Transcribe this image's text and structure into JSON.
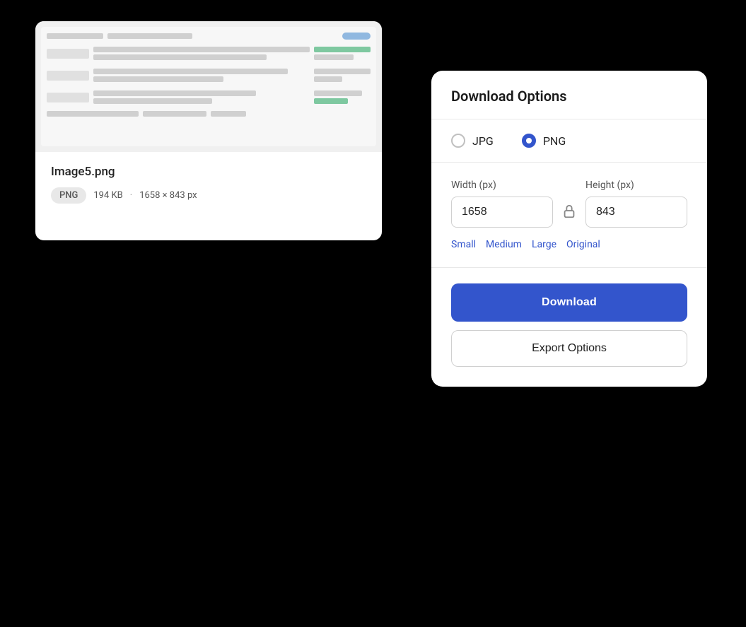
{
  "bg_card": {
    "filename": "Image5.png",
    "badge": "PNG",
    "file_size": "194 KB",
    "dot": "·",
    "dimensions": "1658 × 843 px"
  },
  "fg_card": {
    "title": "Download Options",
    "format_section": {
      "options": [
        {
          "id": "jpg",
          "label": "JPG",
          "selected": false
        },
        {
          "id": "png",
          "label": "PNG",
          "selected": true
        }
      ]
    },
    "dimensions": {
      "width_label": "Width (px)",
      "height_label": "Height (px)",
      "width_value": "1658",
      "height_value": "843"
    },
    "presets": [
      "Small",
      "Medium",
      "Large",
      "Original"
    ],
    "download_button": "Download",
    "export_button": "Export Options"
  },
  "colors": {
    "accent": "#3355cc",
    "border": "#e8e8e8",
    "text_primary": "#1a1a1a",
    "text_secondary": "#555"
  }
}
